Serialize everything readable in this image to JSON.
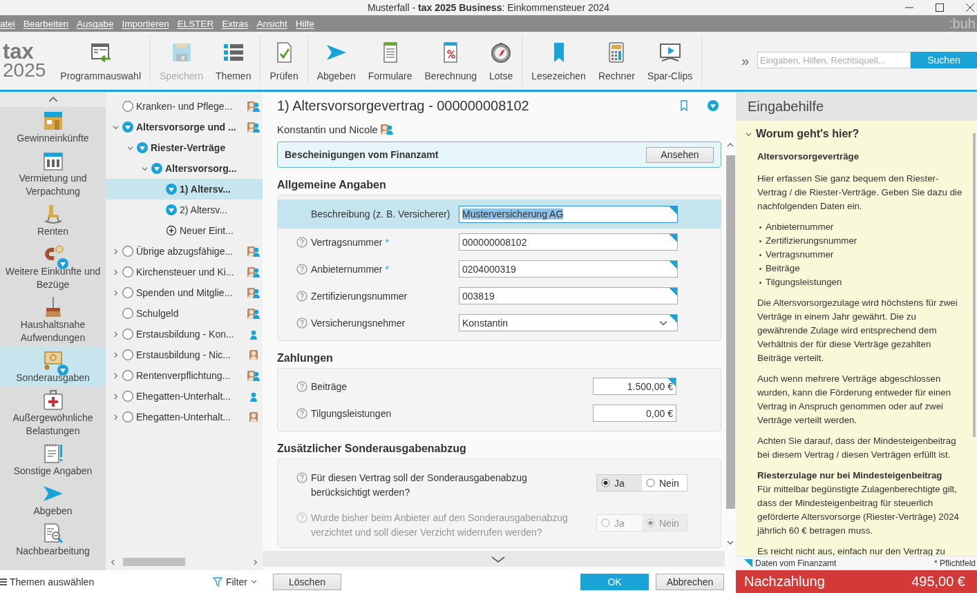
{
  "window": {
    "title": "Musterfall - **tax 2025 Business**: Einkommensteuer 2024"
  },
  "menu": [
    "atei",
    "Bearbeiten",
    "Ausgabe",
    "Importieren",
    "ELSTER",
    "Extras",
    "Ansicht",
    "Hilfe"
  ],
  "brand": ":buh",
  "logo": {
    "word": "tax",
    "year": "2025"
  },
  "toolbar_groups": [
    [
      {
        "label": "Programmauswahl",
        "disabled": false
      }
    ],
    [
      {
        "label": "Speichern",
        "disabled": true
      },
      {
        "label": "Themen",
        "disabled": false
      }
    ],
    [
      {
        "label": "Prüfen",
        "disabled": false
      }
    ],
    [
      {
        "label": "Abgeben",
        "disabled": false
      },
      {
        "label": "Formulare",
        "disabled": false
      },
      {
        "label": "Berechnung",
        "disabled": false
      },
      {
        "label": "Lotse",
        "disabled": false
      }
    ],
    [
      {
        "label": "Lesezeichen",
        "disabled": false
      },
      {
        "label": "Rechner",
        "disabled": false
      },
      {
        "label": "Spar-Clips",
        "disabled": false
      }
    ]
  ],
  "search": {
    "more": "»",
    "placeholder": "Eingaben, Hilfen, Rechtsquell...",
    "button": "Suchen"
  },
  "nav": {
    "items": [
      {
        "label": "Gewinneinkünfte",
        "selected": false,
        "has_data": false
      },
      {
        "label": "Vermietung und Verpachtung",
        "selected": false,
        "has_data": false
      },
      {
        "label": "Renten",
        "selected": false,
        "has_data": false
      },
      {
        "label": "Weitere Einkünfte und Bezüge",
        "selected": false,
        "has_data": true
      },
      {
        "label": "Haushaltsnahe Aufwendungen",
        "selected": false,
        "has_data": false
      },
      {
        "label": "Sonderausgaben",
        "selected": true,
        "has_data": true
      },
      {
        "label": "Außergewöhnliche Belastungen",
        "selected": false,
        "has_data": false
      },
      {
        "label": "Sonstige Angaben",
        "selected": false,
        "has_data": false
      },
      {
        "label": "Abgeben",
        "selected": false,
        "has_data": false
      },
      {
        "label": "Nachbearbeitung",
        "selected": false,
        "has_data": false
      }
    ]
  },
  "tree": [
    {
      "label": "Kranken- und Pflege...",
      "kind": "topic",
      "done": false,
      "emphasized": false,
      "selected": false,
      "him": true,
      "her": true
    },
    {
      "label": "Altersvorsorge und ...",
      "expandable": true,
      "expanded": true,
      "kind": "topic",
      "done": true,
      "emphasized": true,
      "selected": false,
      "him": true,
      "her": true,
      "children": [
        {
          "label": "Riester-Verträge",
          "expandable": true,
          "expanded": true,
          "kind": "topic",
          "done": true,
          "emphasized": true,
          "selected": false,
          "children": [
            {
              "label": "Altersvorsorg...",
              "expandable": true,
              "expanded": true,
              "kind": "topic",
              "done": true,
              "emphasized": true,
              "selected": false,
              "children": [
                {
                  "label": "1) Altersv...",
                  "kind": "topic",
                  "done": true,
                  "emphasized": true,
                  "selected": true
                },
                {
                  "label": "2) Altersv...",
                  "kind": "topic",
                  "done": true,
                  "emphasized": false,
                  "selected": false
                },
                {
                  "label": "Neuer Eint...",
                  "kind": "add",
                  "emphasized": false,
                  "selected": false
                }
              ]
            }
          ]
        }
      ]
    },
    {
      "label": "Übrige abzugsfähige...",
      "expandable": true,
      "expanded": false,
      "kind": "topic",
      "done": false,
      "emphasized": false,
      "selected": false,
      "him": true,
      "her": true
    },
    {
      "label": "Kirchensteuer und Ki...",
      "expandable": true,
      "expanded": false,
      "kind": "topic",
      "done": false,
      "emphasized": false,
      "selected": false,
      "him": true,
      "her": true
    },
    {
      "label": "Spenden und Mitglie...",
      "expandable": true,
      "expanded": false,
      "kind": "topic",
      "done": false,
      "emphasized": false,
      "selected": false,
      "him": true,
      "her": true
    },
    {
      "label": "Schulgeld",
      "kind": "topic",
      "done": false,
      "emphasized": false,
      "selected": false,
      "him": true,
      "her": true
    },
    {
      "label": "Erstausbildung - Kon...",
      "expandable": true,
      "expanded": false,
      "kind": "topic",
      "done": false,
      "emphasized": false,
      "selected": false,
      "him": true,
      "her": false
    },
    {
      "label": "Erstausbildung - Nic...",
      "expandable": true,
      "expanded": false,
      "kind": "topic",
      "done": false,
      "emphasized": false,
      "selected": false,
      "him": false,
      "her": true
    },
    {
      "label": "Rentenverpflichtung...",
      "expandable": true,
      "expanded": false,
      "kind": "topic",
      "done": false,
      "emphasized": false,
      "selected": false,
      "him": true,
      "her": true
    },
    {
      "label": "Ehegatten-Unterhalt...",
      "expandable": true,
      "expanded": false,
      "kind": "topic",
      "done": false,
      "emphasized": false,
      "selected": false,
      "him": true,
      "her": false
    },
    {
      "label": "Ehegatten-Unterhalt...",
      "expandable": true,
      "expanded": false,
      "kind": "topic",
      "done": false,
      "emphasized": false,
      "selected": false,
      "him": false,
      "her": true
    }
  ],
  "left_footer": {
    "topics": "Themen auswählen",
    "filter": "Filter"
  },
  "form": {
    "title": "1) Altersvorsorgevertrag - 000000008102",
    "done": true,
    "persons": "Konstantin und Nicole",
    "notice": {
      "text": "Bescheinigungen vom Finanzamt",
      "button": "Ansehen"
    },
    "sections": [
      {
        "title": "Allgemeine Angaben",
        "rows": [
          {
            "kind": "text",
            "label": "Beschreibung (z. B. Versicherer)",
            "help": false,
            "value": "Musterversicherung AG",
            "selected": true,
            "from_office": true
          },
          {
            "kind": "text",
            "label": "Vertragsnummer",
            "help": true,
            "mark": "*",
            "value": "000000008102",
            "selected": false,
            "from_office": true
          },
          {
            "kind": "text",
            "label": "Anbieternummer",
            "help": true,
            "mark": "*",
            "value": "0204000319",
            "selected": false,
            "from_office": true
          },
          {
            "kind": "text",
            "label": "Zertifizierungsnummer",
            "help": true,
            "value": "003819",
            "selected": false,
            "from_office": true
          },
          {
            "kind": "select",
            "label": "Versicherungsnehmer",
            "help": true,
            "value": "Konstantin",
            "selected": false,
            "from_office": true
          }
        ]
      },
      {
        "title": "Zahlungen",
        "rows": [
          {
            "kind": "amount",
            "label": "Beiträge",
            "help": true,
            "value": "1.500,00 €",
            "selected": false,
            "from_office": true
          },
          {
            "kind": "amount",
            "label": "Tilgungsleistungen",
            "help": true,
            "value": "0,00 €",
            "selected": false,
            "from_office": false
          }
        ]
      },
      {
        "title": "Zusätzlicher Sonderausgabenabzug",
        "rows": [
          {
            "kind": "choice",
            "label": "Für diesen Vertrag soll der Sonderausgabenabzug berücksichtigt werden?",
            "help": true,
            "disabled": false,
            "selected": false,
            "options": [
              {
                "label": "Ja",
                "selected": true
              },
              {
                "label": "Nein",
                "selected": false
              }
            ]
          },
          {
            "kind": "choice",
            "label": "Wurde bisher beim Anbieter auf den Sonderausgabenabzug verzichtet und soll dieser Verzicht widerrufen werden?",
            "help": true,
            "disabled": true,
            "selected": false,
            "options": [
              {
                "label": "Ja",
                "selected": false
              },
              {
                "label": "Nein",
                "selected": true
              }
            ]
          }
        ]
      }
    ]
  },
  "buttons": [
    {
      "label": "Löschen",
      "kind": "secondary"
    },
    {
      "label": "OK",
      "kind": "primary"
    },
    {
      "label": "Abbrechen",
      "kind": "secondary"
    }
  ],
  "help": {
    "title": "Eingabehilfe",
    "section": "Worum geht's hier?",
    "blocks": [
      {
        "kind": "heading",
        "text": "Altersvorsorgeverträge"
      },
      {
        "kind": "paragraph",
        "text": "Hier erfassen Sie ganz bequem den Riester-Vertrag / die Riester-Verträge. Geben Sie dazu die nachfolgenden Daten ein."
      },
      {
        "kind": "list",
        "items": [
          "Anbieternummer",
          "Zertifizierungsnummer",
          "Vertragsnummer",
          "Beiträge",
          "Tilgungsleistungen"
        ]
      },
      {
        "kind": "paragraph",
        "text": "Die Altersvorsorgezulage wird höchstens für zwei Verträge in einem Jahr gewährt. Die zu gewährende Zulage wird entsprechend dem Verhältnis der für diese Verträge gezahlten Beiträge verteilt."
      },
      {
        "kind": "paragraph",
        "text": "Auch wenn mehrere Verträge abgeschlossen wurden, kann die Förderung entweder für einen Vertrag in Anspruch genommen oder auf zwei Verträge verteilt werden."
      },
      {
        "kind": "paragraph",
        "text": "Achten Sie darauf, dass der Mindesteigenbeitrag bei diesem Vertrag / diesen Verträgen erfüllt ist."
      },
      {
        "kind": "titled",
        "title": "Riesterzulage nur bei Mindesteigenbeitrag",
        "text": "Für mittelbar begünstigte Zulagenberechtigte gilt, dass der Mindesteigenbeitrag für steuerlich geförderte Altersvorsorge (Riester-Verträge) 2024 jährlich 60 € betragen muss."
      },
      {
        "kind": "paragraph",
        "text": "Es reicht nicht aus, einfach nur den Vertrag zu"
      }
    ],
    "legend": "Daten vom Finanzamt",
    "required_note": "* Pflichtfeld"
  },
  "total": {
    "label": "Nachzahlung",
    "amount": "495,00 €"
  }
}
